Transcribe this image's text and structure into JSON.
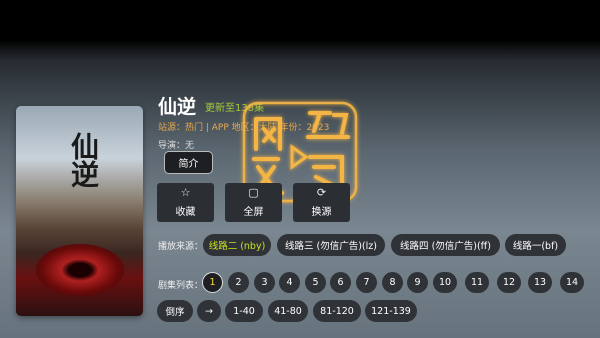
{
  "detail": {
    "title": "仙逆",
    "update_status": "更新至138集",
    "site_line": "站源：热门 | APP    地区：大陆    年份：2023",
    "director": "导演：无",
    "intro_label": "简介"
  },
  "poster": {
    "title_text": "仙逆"
  },
  "actions": [
    {
      "icon": "star-icon",
      "glyph": "☆",
      "label": "收藏"
    },
    {
      "icon": "fullscreen-icon",
      "glyph": "▢",
      "label": "全屏"
    },
    {
      "icon": "switch-source-icon",
      "glyph": "⟳",
      "label": "换源"
    }
  ],
  "sources": {
    "label": "播放来源：",
    "items": [
      "线路二 (nby)",
      "线路三 (勿信广告)(lz)",
      "线路四 (勿信广告)(ff)",
      "线路一(bf)"
    ],
    "active": "线路二 (nby)"
  },
  "episodes": {
    "label": "剧集列表：",
    "numbers": [
      "1",
      "2",
      "3",
      "4",
      "5",
      "6",
      "7",
      "8",
      "9",
      "10",
      "11",
      "12",
      "13",
      "14"
    ],
    "selected": "1"
  },
  "ranges": {
    "reverse_label": "倒序",
    "arrow": "→",
    "items": [
      "1-40",
      "41-80",
      "81-120",
      "121-139"
    ]
  },
  "colors": {
    "accent_green": "#a4cc3a",
    "site_orange": "#e7a94b",
    "selected_episode": "#ffd93a"
  }
}
